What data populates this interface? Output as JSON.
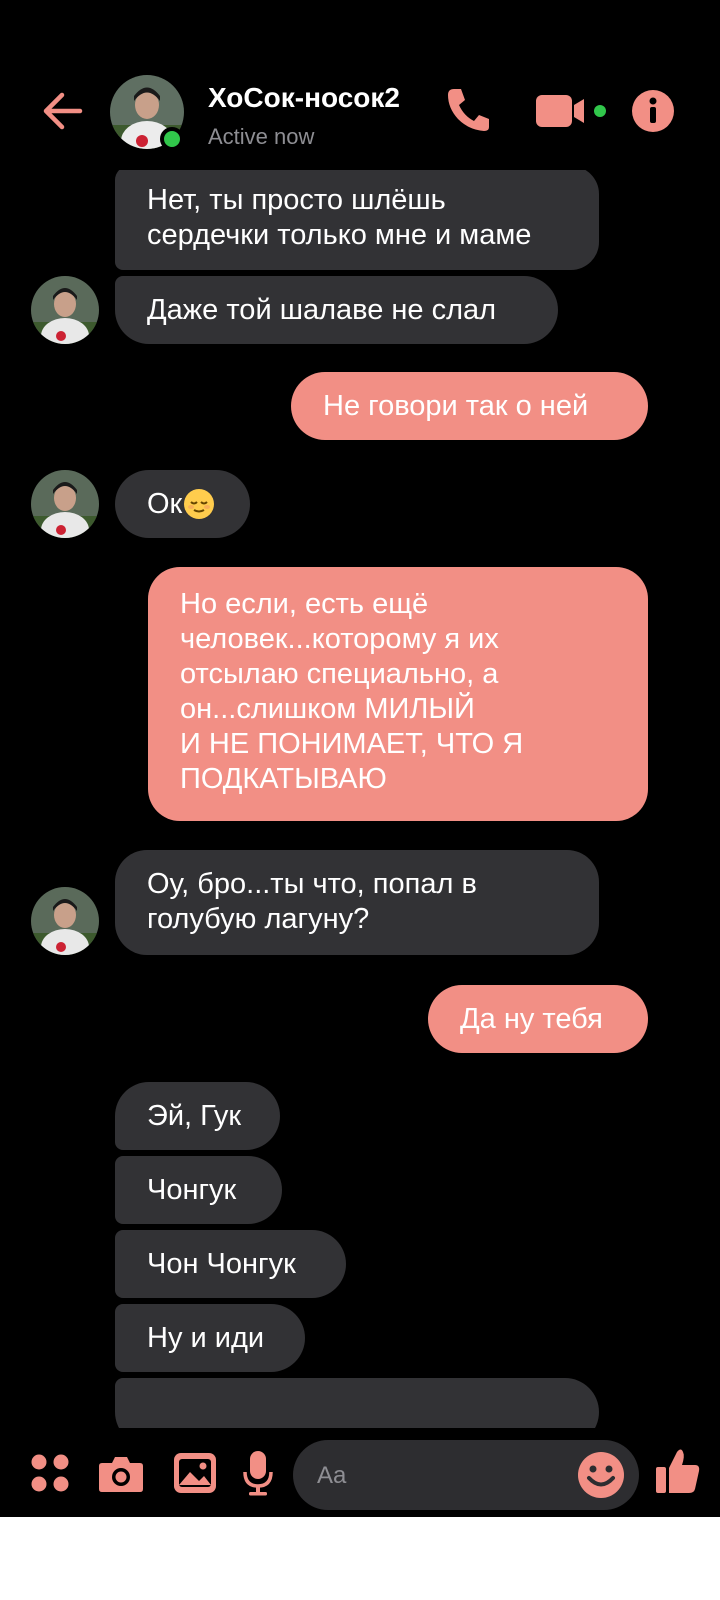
{
  "header": {
    "contact_name": "ХоСок-носок2",
    "status": "Active now"
  },
  "messages": [
    {
      "side": "in",
      "text_lines": [
        "Нет, ты просто шлёшь",
        "сердечки только мне и маме"
      ]
    },
    {
      "side": "in",
      "text": "Даже той шалаве не слал"
    },
    {
      "side": "out",
      "text": "Не говори так о ней"
    },
    {
      "side": "in",
      "text": "Ок"
    },
    {
      "side": "out",
      "text_lines": [
        "Но если, есть ещё",
        "человек...которому я их",
        "отсылаю специально, а",
        "он...слишком МИЛЫЙ",
        "И НЕ ПОНИМАЕТ, ЧТО Я",
        "ПОДКАТЫВАЮ"
      ]
    },
    {
      "side": "in",
      "text_lines": [
        "Оу, бро...ты что, попал в",
        "голубую лагуну?"
      ]
    },
    {
      "side": "out",
      "text": "Да ну тебя"
    },
    {
      "side": "in",
      "text": "Эй, Гук"
    },
    {
      "side": "in",
      "text": "Чонгук"
    },
    {
      "side": "in",
      "text": "Чон Чонгук"
    },
    {
      "side": "in",
      "text": "Ну и иди"
    }
  ],
  "composer": {
    "placeholder": "Aa"
  },
  "icons": {
    "back": "arrow-left-icon",
    "call": "phone-icon",
    "video": "video-camera-icon",
    "info": "info-icon",
    "menu": "four-dots-icon",
    "camera": "camera-icon",
    "gallery": "image-icon",
    "mic": "microphone-icon",
    "emoji": "smiley-icon",
    "like": "thumbs-up-icon"
  },
  "colors": {
    "accent": "#f28f85",
    "incoming_bubble": "#323235",
    "background": "#000000",
    "online": "#31c74b"
  }
}
